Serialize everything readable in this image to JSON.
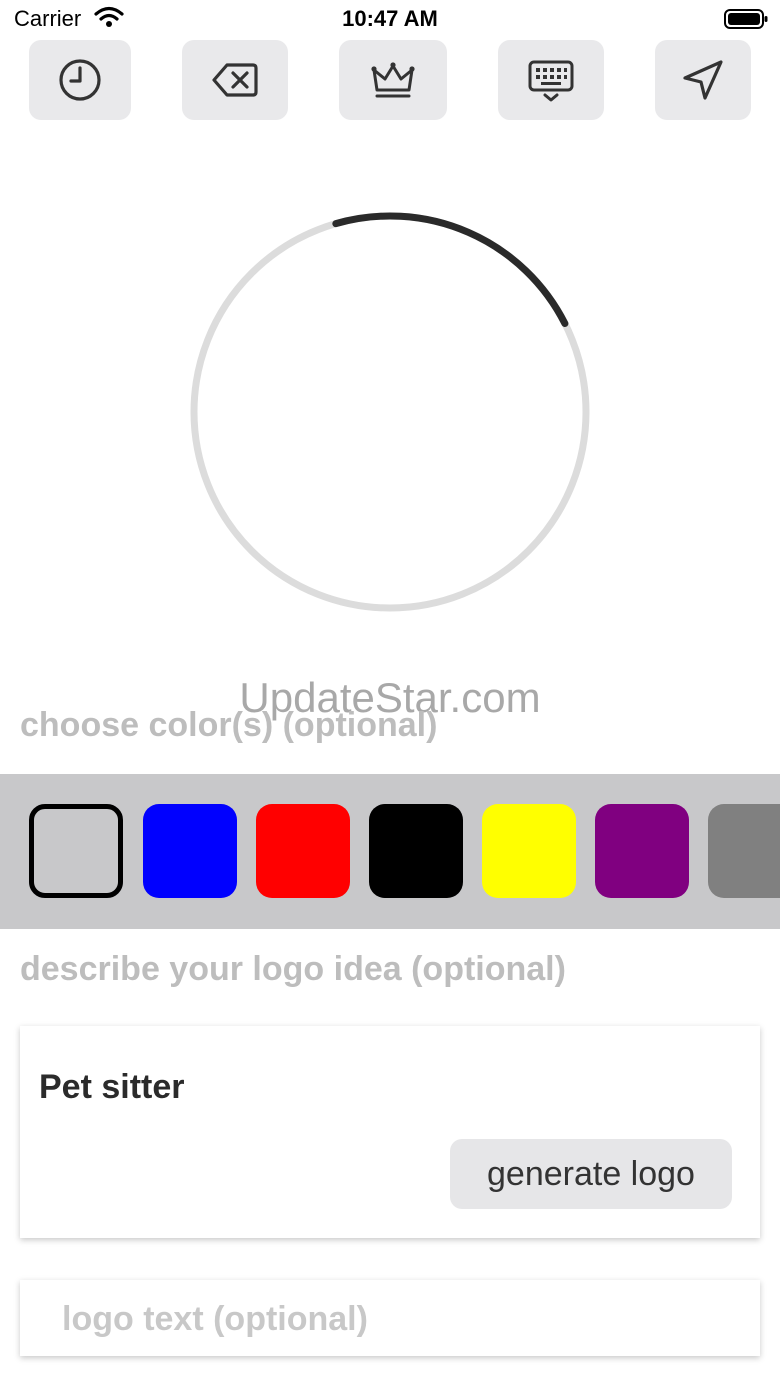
{
  "status_bar": {
    "carrier": "Carrier",
    "time": "10:47 AM"
  },
  "toolbar": {
    "buttons": [
      {
        "icon": "history-clock-icon"
      },
      {
        "icon": "delete-backspace-icon"
      },
      {
        "icon": "crown-icon"
      },
      {
        "icon": "keyboard-icon"
      },
      {
        "icon": "send-icon"
      }
    ]
  },
  "progress": {
    "fraction": 0.22,
    "track_color": "#dcdcdc",
    "fill_color": "#2a2a2a"
  },
  "watermark": "UpdateStar.com",
  "colors": {
    "label": "choose color(s) (optional)",
    "swatches": [
      {
        "name": "none",
        "hex": "#c8c8ca",
        "selected": true
      },
      {
        "name": "blue",
        "hex": "#0000ff",
        "selected": false
      },
      {
        "name": "red",
        "hex": "#ff0000",
        "selected": false
      },
      {
        "name": "black",
        "hex": "#000000",
        "selected": false
      },
      {
        "name": "yellow",
        "hex": "#ffff00",
        "selected": false
      },
      {
        "name": "purple",
        "hex": "#800080",
        "selected": false
      },
      {
        "name": "gray",
        "hex": "#808080",
        "selected": false
      }
    ]
  },
  "idea": {
    "label": "describe your logo idea (optional)",
    "value": "Pet sitter",
    "generate_label": "generate logo"
  },
  "logo_text": {
    "placeholder": "logo text (optional)",
    "value": ""
  }
}
